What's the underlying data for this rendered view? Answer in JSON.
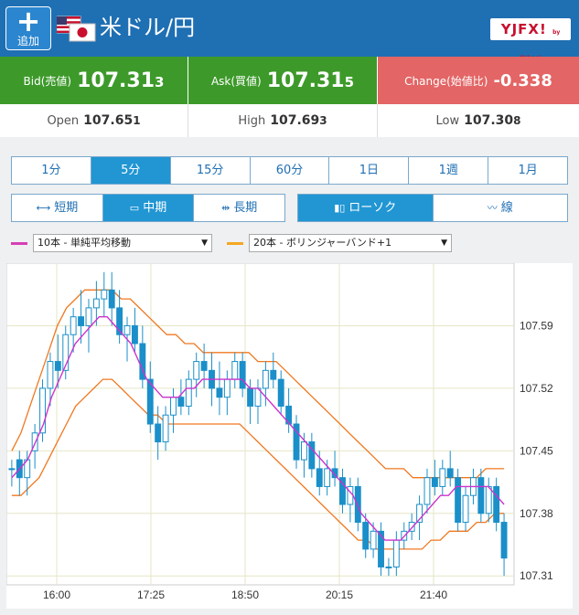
{
  "header": {
    "add_label": "追加",
    "pair_title": "米ドル/円",
    "logo_text": "YJFX!",
    "logo_sub": "by Yahoo!",
    "bg_color": "#1f6fb3"
  },
  "quotes": {
    "bid": {
      "label": "Bid(売値)",
      "main": "107.31",
      "small": "3"
    },
    "ask": {
      "label": "Ask(買値)",
      "main": "107.31",
      "small": "5"
    },
    "change": {
      "label": "Change(始値比)",
      "value": "-0.338"
    }
  },
  "ohl": {
    "open": {
      "label": "Open",
      "main": "107.65",
      "small": "1"
    },
    "high": {
      "label": "High",
      "main": "107.69",
      "small": "3"
    },
    "low": {
      "label": "Low",
      "main": "107.30",
      "small": "8"
    }
  },
  "timeframes": [
    "1分",
    "5分",
    "15分",
    "60分",
    "1日",
    "1週",
    "1月"
  ],
  "timeframe_active": 1,
  "terms": [
    "短期",
    "中期",
    "長期"
  ],
  "term_active": 1,
  "chart_types": [
    "ローソク",
    "線"
  ],
  "chart_type_active": 0,
  "indicators": {
    "ma": {
      "label": "10本 - 単純平均移動",
      "color": "#d63fb5"
    },
    "bb": {
      "label": "20本 - ボリンジャーバンド+1",
      "color": "#f5a623"
    }
  },
  "chart_data": {
    "type": "candlestick",
    "ylabels": [
      "107.59",
      "107.52",
      "107.45",
      "107.38",
      "107.31"
    ],
    "xlabels": [
      "16:00",
      "17:25",
      "18:50",
      "20:15",
      "21:40"
    ],
    "ylim": [
      107.3,
      107.66
    ],
    "grid": true,
    "colors": {
      "candle": "#1a8fc9",
      "ma": "#cc33cc",
      "band": "#f07820",
      "grid": "#e6e6c8"
    },
    "candles": [
      [
        107.43,
        107.44,
        107.41,
        107.43
      ],
      [
        107.44,
        107.45,
        107.4,
        107.42
      ],
      [
        107.42,
        107.45,
        107.4,
        107.44
      ],
      [
        107.45,
        107.48,
        107.43,
        107.47
      ],
      [
        107.47,
        107.53,
        107.46,
        107.52
      ],
      [
        107.52,
        107.56,
        107.5,
        107.55
      ],
      [
        107.55,
        107.58,
        107.52,
        107.54
      ],
      [
        107.54,
        107.59,
        107.53,
        107.58
      ],
      [
        107.58,
        107.61,
        107.56,
        107.6
      ],
      [
        107.6,
        107.63,
        107.57,
        107.59
      ],
      [
        107.59,
        107.62,
        107.56,
        107.61
      ],
      [
        107.61,
        107.64,
        107.59,
        107.62
      ],
      [
        107.62,
        107.65,
        107.6,
        107.63
      ],
      [
        107.63,
        107.65,
        107.59,
        107.61
      ],
      [
        107.61,
        107.63,
        107.57,
        107.58
      ],
      [
        107.58,
        107.6,
        107.55,
        107.59
      ],
      [
        107.59,
        107.61,
        107.56,
        107.57
      ],
      [
        107.57,
        107.59,
        107.52,
        107.53
      ],
      [
        107.53,
        107.55,
        107.47,
        107.48
      ],
      [
        107.48,
        107.5,
        107.44,
        107.46
      ],
      [
        107.46,
        107.5,
        107.45,
        107.49
      ],
      [
        107.49,
        107.52,
        107.47,
        107.51
      ],
      [
        107.51,
        107.53,
        107.49,
        107.5
      ],
      [
        107.5,
        107.54,
        107.49,
        107.53
      ],
      [
        107.53,
        107.56,
        107.51,
        107.55
      ],
      [
        107.55,
        107.57,
        107.52,
        107.54
      ],
      [
        107.54,
        107.56,
        107.5,
        107.52
      ],
      [
        107.52,
        107.55,
        107.49,
        107.51
      ],
      [
        107.51,
        107.54,
        107.49,
        107.53
      ],
      [
        107.53,
        107.56,
        107.52,
        107.55
      ],
      [
        107.55,
        107.56,
        107.51,
        107.52
      ],
      [
        107.52,
        107.53,
        107.48,
        107.5
      ],
      [
        107.5,
        107.53,
        107.48,
        107.52
      ],
      [
        107.52,
        107.55,
        107.5,
        107.54
      ],
      [
        107.54,
        107.56,
        107.52,
        107.53
      ],
      [
        107.53,
        107.54,
        107.49,
        107.5
      ],
      [
        107.5,
        107.52,
        107.47,
        107.48
      ],
      [
        107.48,
        107.49,
        107.43,
        107.44
      ],
      [
        107.44,
        107.47,
        107.42,
        107.46
      ],
      [
        107.46,
        107.47,
        107.42,
        107.43
      ],
      [
        107.43,
        107.45,
        107.4,
        107.41
      ],
      [
        107.41,
        107.44,
        107.4,
        107.43
      ],
      [
        107.43,
        107.45,
        107.41,
        107.42
      ],
      [
        107.42,
        107.43,
        107.38,
        107.39
      ],
      [
        107.39,
        107.42,
        107.37,
        107.41
      ],
      [
        107.41,
        107.42,
        107.36,
        107.37
      ],
      [
        107.37,
        107.38,
        107.33,
        107.34
      ],
      [
        107.34,
        107.37,
        107.33,
        107.36
      ],
      [
        107.36,
        107.37,
        107.31,
        107.32
      ],
      [
        107.32,
        107.33,
        107.31,
        107.32
      ],
      [
        107.32,
        107.36,
        107.31,
        107.35
      ],
      [
        107.35,
        107.37,
        107.34,
        107.36
      ],
      [
        107.36,
        107.38,
        107.35,
        107.37
      ],
      [
        107.37,
        107.4,
        107.35,
        107.39
      ],
      [
        107.39,
        107.43,
        107.38,
        107.42
      ],
      [
        107.42,
        107.44,
        107.4,
        107.41
      ],
      [
        107.41,
        107.44,
        107.4,
        107.43
      ],
      [
        107.43,
        107.45,
        107.41,
        107.42
      ],
      [
        107.42,
        107.43,
        107.36,
        107.37
      ],
      [
        107.37,
        107.41,
        107.36,
        107.4
      ],
      [
        107.4,
        107.43,
        107.39,
        107.42
      ],
      [
        107.42,
        107.43,
        107.37,
        107.38
      ],
      [
        107.38,
        107.42,
        107.37,
        107.41
      ],
      [
        107.41,
        107.42,
        107.36,
        107.37
      ],
      [
        107.37,
        107.38,
        107.31,
        107.33
      ]
    ],
    "ma_values": [
      107.42,
      107.43,
      107.44,
      107.46,
      107.48,
      107.51,
      107.53,
      107.55,
      107.57,
      107.58,
      107.59,
      107.6,
      107.6,
      107.59,
      107.58,
      107.57,
      107.55,
      107.53,
      107.52,
      107.51,
      107.51,
      107.51,
      107.52,
      107.52,
      107.53,
      107.53,
      107.53,
      107.53,
      107.53,
      107.53,
      107.52,
      107.52,
      107.51,
      107.5,
      107.49,
      107.48,
      107.47,
      107.46,
      107.45,
      107.44,
      107.43,
      107.42,
      107.41,
      107.4,
      107.38,
      107.37,
      107.36,
      107.35,
      107.35,
      107.35,
      107.36,
      107.37,
      107.38,
      107.39,
      107.4,
      107.4,
      107.41,
      107.41,
      107.41,
      107.41,
      107.41,
      107.4,
      107.39
    ],
    "bb_upper": [
      107.45,
      107.47,
      107.5,
      107.53,
      107.56,
      107.59,
      107.61,
      107.62,
      107.63,
      107.63,
      107.63,
      107.63,
      107.62,
      107.62,
      107.61,
      107.6,
      107.59,
      107.58,
      107.58,
      107.57,
      107.57,
      107.56,
      107.56,
      107.56,
      107.56,
      107.56,
      107.56,
      107.55,
      107.55,
      107.55,
      107.54,
      107.53,
      107.52,
      107.51,
      107.5,
      107.49,
      107.48,
      107.47,
      107.46,
      107.45,
      107.44,
      107.43,
      107.43,
      107.43,
      107.42,
      107.42,
      107.42,
      107.42,
      107.42,
      107.42,
      107.42,
      107.42,
      107.43,
      107.43,
      107.43
    ],
    "bb_lower": [
      107.4,
      107.4,
      107.41,
      107.42,
      107.44,
      107.46,
      107.48,
      107.5,
      107.51,
      107.52,
      107.53,
      107.53,
      107.52,
      107.51,
      107.5,
      107.49,
      107.49,
      107.48,
      107.48,
      107.48,
      107.48,
      107.48,
      107.48,
      107.48,
      107.48,
      107.48,
      107.47,
      107.46,
      107.45,
      107.44,
      107.43,
      107.42,
      107.41,
      107.4,
      107.39,
      107.38,
      107.37,
      107.36,
      107.35,
      107.35,
      107.34,
      107.34,
      107.34,
      107.34,
      107.34,
      107.34,
      107.35,
      107.35,
      107.36,
      107.36,
      107.36,
      107.37,
      107.37,
      107.38,
      107.38
    ]
  }
}
